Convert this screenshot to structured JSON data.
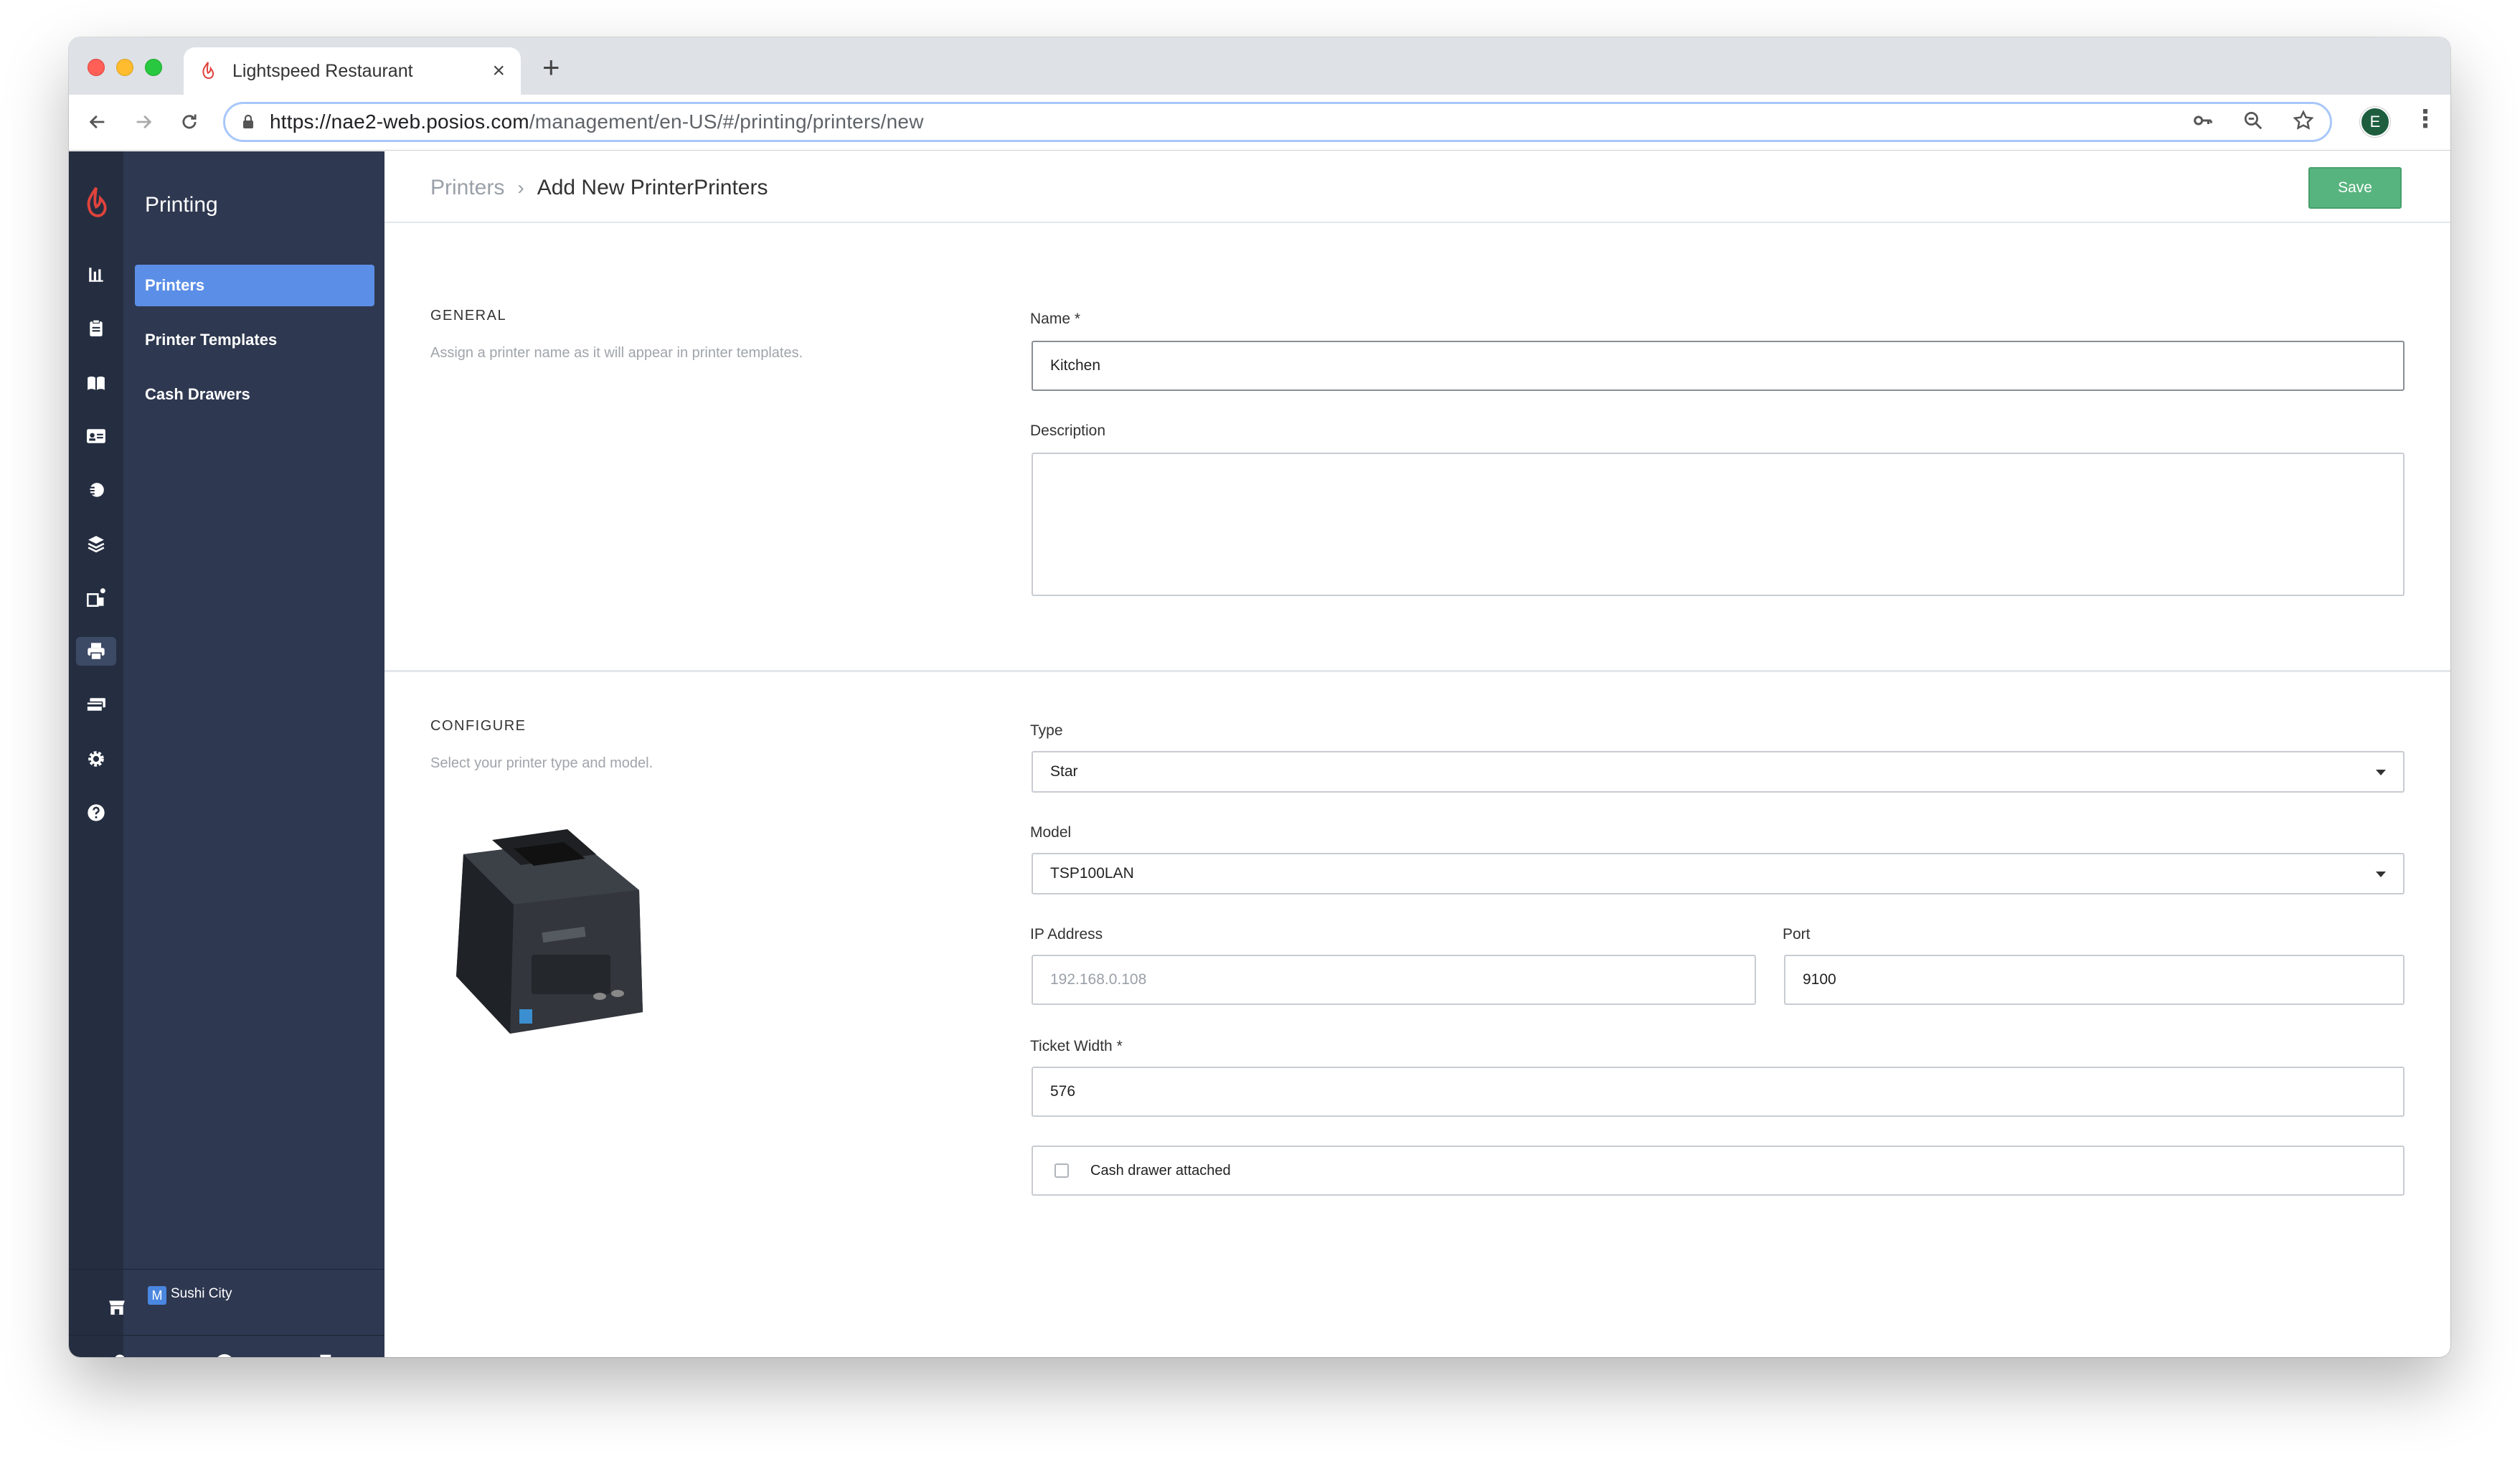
{
  "browser": {
    "tab_title": "Lightspeed Restaurant",
    "new_tab_symbol": "+",
    "close_symbol": "×",
    "url_host": "https://nae2-web.posios.com",
    "url_path": "/management/en-US/#/printing/printers/new",
    "profile_initial": "E",
    "icons": [
      "back-icon",
      "forward-icon",
      "reload-icon",
      "lock-icon",
      "key-icon",
      "zoom-icon",
      "star-icon",
      "menu-icon"
    ]
  },
  "sidebar": {
    "section_title": "Printing",
    "items": [
      {
        "label": "Printers",
        "active": true
      },
      {
        "label": "Printer Templates",
        "active": false
      },
      {
        "label": "Cash Drawers",
        "active": false
      }
    ],
    "store": {
      "badge": "M",
      "name": "Sushi City"
    }
  },
  "header": {
    "breadcrumb_root": "Printers",
    "breadcrumb_current": "Add New PrinterPrinters",
    "save_label": "Save"
  },
  "general": {
    "title": "GENERAL",
    "description": "Assign a printer name as it will appear in printer templates.",
    "name_label": "Name *",
    "name_value": "Kitchen",
    "description_label": "Description",
    "description_value": ""
  },
  "configure": {
    "title": "CONFIGURE",
    "description": "Select your printer type and model.",
    "type_label": "Type",
    "type_value": "Star",
    "model_label": "Model",
    "model_value": "TSP100LAN",
    "ip_label": "IP Address",
    "ip_placeholder": "192.168.0.108",
    "port_label": "Port",
    "port_value": "9100",
    "ticket_width_label": "Ticket Width *",
    "ticket_width_value": "576",
    "cash_drawer_label": "Cash drawer attached",
    "cash_drawer_checked": false
  },
  "colors": {
    "accent": "#5b8ee6",
    "save": "#58b47f",
    "rail": "#252e41",
    "subnav": "#2e3850",
    "brand": "#e0433c"
  }
}
